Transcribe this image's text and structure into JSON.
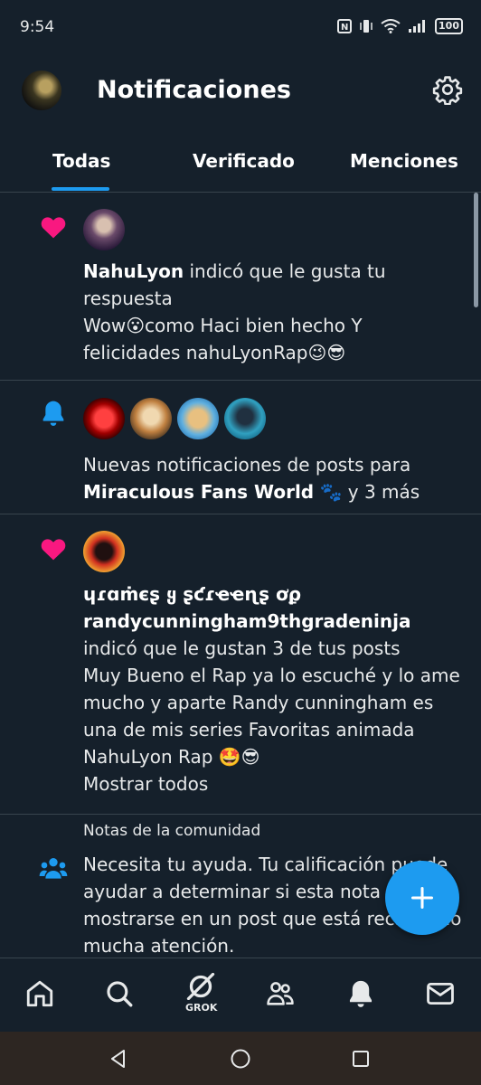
{
  "status_bar": {
    "time": "9:54",
    "battery": "100"
  },
  "header": {
    "title": "Notificaciones",
    "avatar_icon": "user-avatar",
    "settings_icon": "gear-icon"
  },
  "tabs": [
    {
      "label": "Todas",
      "active": true
    },
    {
      "label": "Verificado",
      "active": false
    },
    {
      "label": "Menciones",
      "active": false
    }
  ],
  "notifications": [
    {
      "type": "like",
      "icon": "heart-icon",
      "user": "NahuLyon",
      "action": " indicó que le gusta tu respuesta",
      "text": "Wow😮como Haci bien hecho Y felicidades nahuLyonRap😉😎"
    },
    {
      "type": "posts",
      "icon": "bell-icon",
      "prefix": "Nuevas notificaciones de posts para ",
      "account": "Miraculous Fans World",
      "suffix": " 🐾 y 3 más"
    },
    {
      "type": "like",
      "icon": "heart-icon",
      "user_line1": "ɥɾɑṁєʂ ყ ʂƈɾҽҽɳʂ ơϼ",
      "user_line2": "randycunningham9thgradeninja",
      "action": " indicó que le gustan 3 de tus posts",
      "text": "Muy Bueno el Rap ya lo escuché y lo ame mucho y aparte Randy cunningham es una de mis series Favoritas animada NahuLyon Rap 🤩😎",
      "show_all": "Mostrar todos"
    },
    {
      "type": "community_notes",
      "icon": "people-icon",
      "label": "Notas de la comunidad",
      "text": "Necesita tu ayuda. Tu calificación puede ayudar a determinar si esta nota debe mostrarse en un post que está recibiendo mucha atención."
    }
  ],
  "fab": {
    "icon": "plus-icon"
  },
  "bottom_nav": {
    "items": [
      "home-icon",
      "search-icon",
      "grok-icon",
      "communities-icon",
      "notifications-icon",
      "messages-icon"
    ],
    "grok_label": "GROK"
  },
  "colors": {
    "background": "#15202b",
    "accent": "#1d9bf0",
    "like": "#f91880",
    "divider": "#38444d"
  }
}
